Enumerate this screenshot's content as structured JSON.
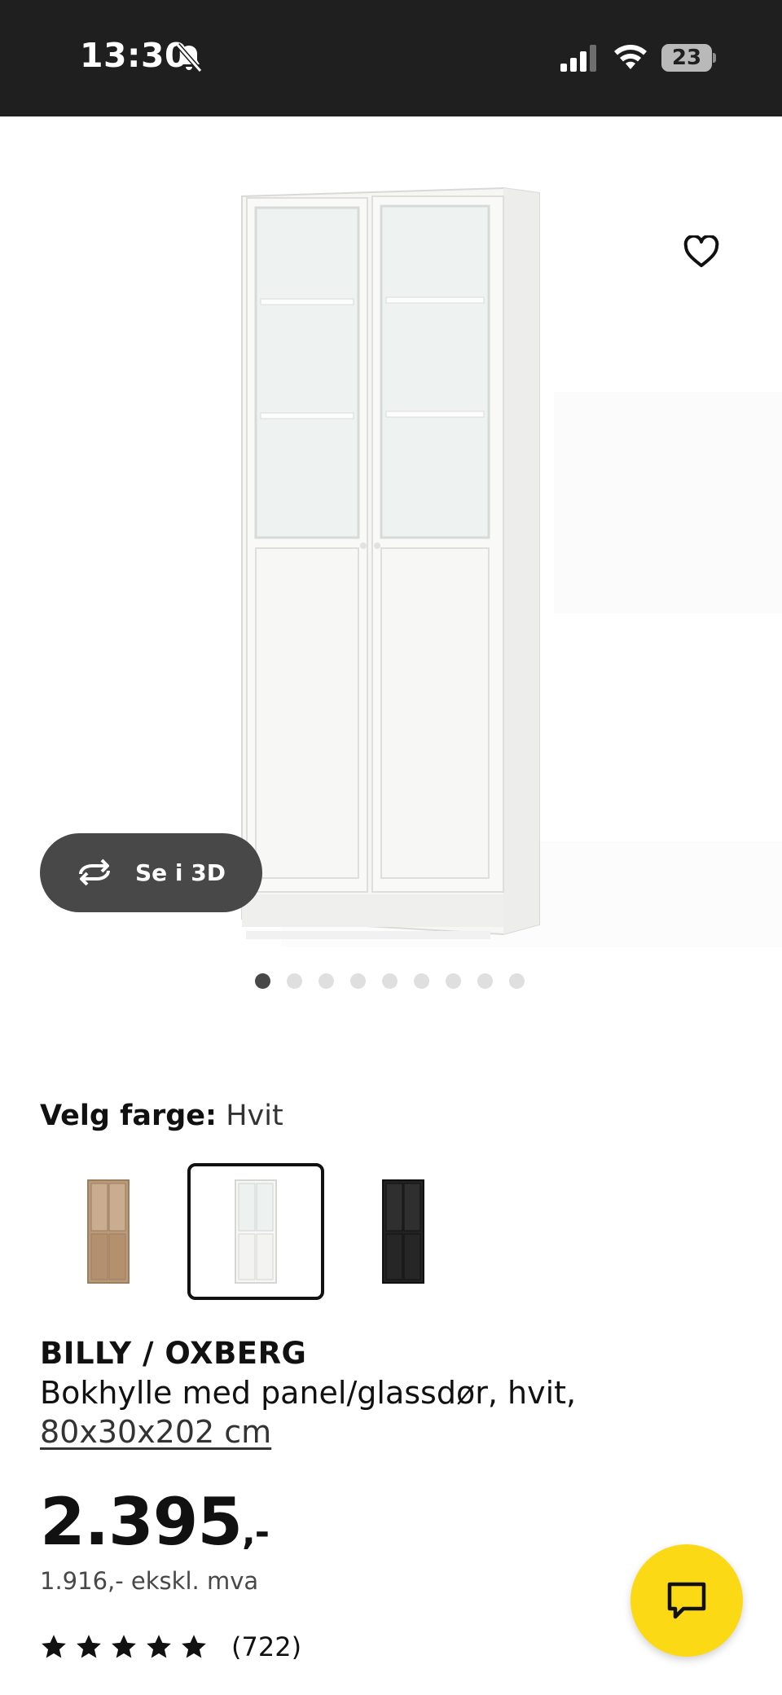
{
  "status_bar": {
    "time": "13:30",
    "battery": "23",
    "icons": [
      "bell-slash-icon",
      "signal-icon",
      "wifi-icon",
      "battery-icon"
    ]
  },
  "gallery": {
    "button_3d_label": "Se i 3D",
    "image_count": 9,
    "active_image": 1,
    "icons": [
      "heart-icon",
      "rotate-3d-icon"
    ]
  },
  "color": {
    "label": "Velg farge:",
    "value": "Hvit",
    "options": [
      {
        "name": "oak",
        "color": "#b99a7a",
        "selected": false
      },
      {
        "name": "white",
        "color": "#f4f4f1",
        "selected": true
      },
      {
        "name": "black",
        "color": "#232323",
        "selected": false
      }
    ]
  },
  "product": {
    "name": "BILLY / OXBERG",
    "description": "Bokhylle med panel/glassdør, hvit,",
    "size": "80x30x202 cm",
    "price": "2.395",
    "price_suffix": ",-",
    "price_excl_vat": "1.916,- ekskl. mva",
    "rating_stars": 5,
    "rating_count": "(722)"
  },
  "colors": {
    "status_bar_bg": "#1f1f1f",
    "button_3d_bg": "#484848",
    "chat_button_bg": "#fbd914"
  }
}
